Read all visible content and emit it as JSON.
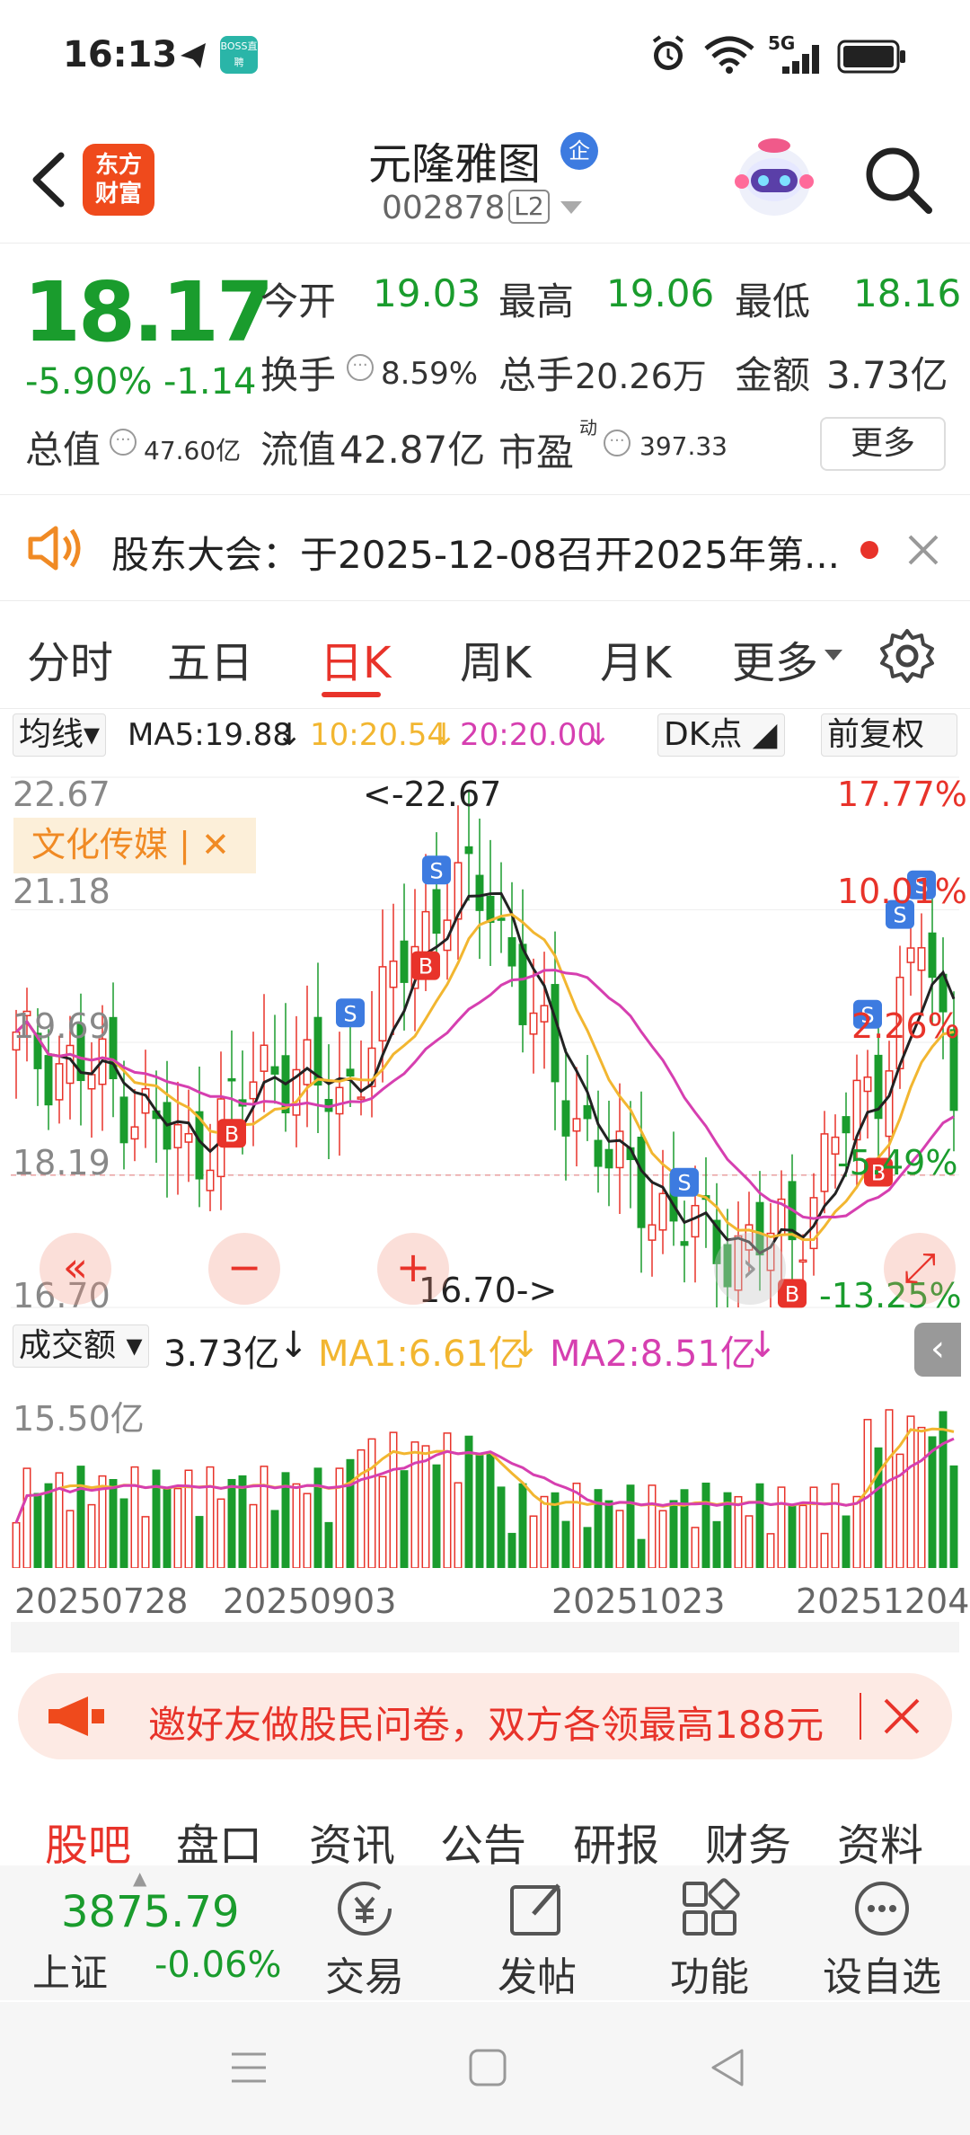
{
  "status_bar": {
    "time": "16:13",
    "boss_badge": "BOSS直聘",
    "network": "5G"
  },
  "header": {
    "logo_text": "东方财富",
    "stock_name": "元隆雅图",
    "qi_badge": "企",
    "stock_code": "002878",
    "level": "L2"
  },
  "quote": {
    "price": "18.17",
    "change_pct": "-5.90%",
    "change_amt": "-1.14",
    "open_label": "今开",
    "open": "19.03",
    "high_label": "最高",
    "high": "19.06",
    "low_label": "最低",
    "low": "18.16",
    "turnover_label": "换手",
    "turnover": "8.59%",
    "volume_label": "总手",
    "volume": "20.26万",
    "amount_label": "金额",
    "amount": "3.73亿",
    "mcap_label": "总值",
    "mcap": "47.60亿",
    "float_label": "流值",
    "float": "42.87亿",
    "pe_label": "市盈",
    "pe_sup": "动",
    "pe": "397.33",
    "more_label": "更多"
  },
  "notice": {
    "text": "股东大会：于2025-12-08召开2025年第..."
  },
  "tabs": {
    "items": [
      "分时",
      "五日",
      "日K",
      "周K",
      "月K",
      "更多"
    ],
    "active": "日K"
  },
  "ma_bar": {
    "ma_select": "均线",
    "ma5": "MA5:19.88",
    "ma10": "10:20.54",
    "ma20": "20:20.00",
    "dk_label": "DK点",
    "adjust_label": "前复权"
  },
  "chart_data": {
    "type": "candlestick",
    "ylim": [
      16.7,
      22.67
    ],
    "y_ticks": [
      "22.67",
      "21.18",
      "19.69",
      "18.19",
      "16.70"
    ],
    "right_ticks": [
      "17.77%",
      "10.01%",
      "2.26%",
      "-5.49%",
      "-13.25%"
    ],
    "max_marker": "<-22.67",
    "min_marker": "16.70->",
    "sector_tag": "文化传媒",
    "x_labels": [
      "20250728",
      "20250903",
      "20251023",
      "20251204"
    ],
    "ma_colors": {
      "ma5": "#222222",
      "ma10": "#f2b630",
      "ma20": "#d63fb0"
    },
    "up_color": "#e8332a",
    "down_color": "#1a9c2d"
  },
  "volume": {
    "select_label": "成交额",
    "value": "3.73亿",
    "ma1": "MA1:6.61亿",
    "ma2": "MA2:8.51亿",
    "max_label": "15.50亿"
  },
  "ad": {
    "text": "邀好友做股民问卷，双方各领最高188元"
  },
  "bottom_tabs": {
    "items": [
      "股吧",
      "盘口",
      "资讯",
      "公告",
      "研报",
      "财务",
      "资料"
    ]
  },
  "toolbar": {
    "index_value": "3875.79",
    "index_name": "上证",
    "index_change": "-0.06%",
    "items": [
      "交易",
      "发帖",
      "功能",
      "设自选"
    ]
  }
}
